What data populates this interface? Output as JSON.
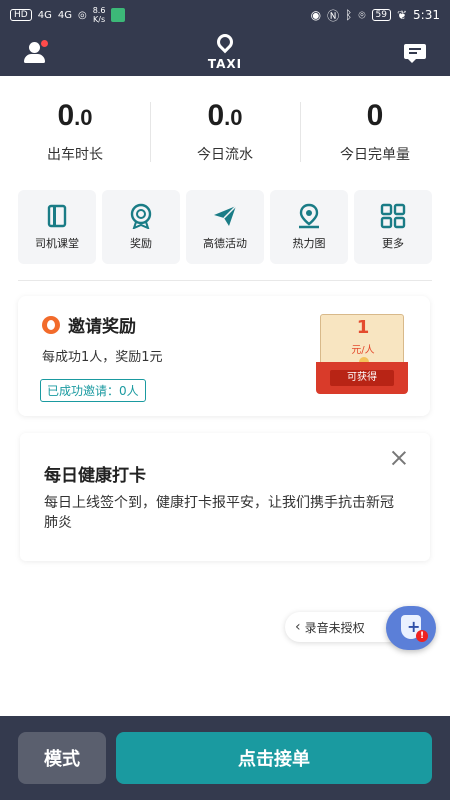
{
  "status_bar": {
    "network_badge": "HD",
    "signal_1": "4G",
    "signal_2": "4G",
    "speed_value": "8.6",
    "speed_unit": "K/s",
    "battery": "59",
    "time": "5:31"
  },
  "header": {
    "logo_text": "TAXI"
  },
  "stats": [
    {
      "value_main": "0",
      "value_decimal": ".0",
      "label": "出车时长"
    },
    {
      "value_main": "0",
      "value_decimal": ".0",
      "label": "今日流水"
    },
    {
      "value_main": "0",
      "value_decimal": "",
      "label": "今日完单量"
    }
  ],
  "tools": [
    {
      "icon": "book-icon",
      "label": "司机课堂"
    },
    {
      "icon": "medal-icon",
      "label": "奖励"
    },
    {
      "icon": "paper-plane-icon",
      "label": "高德活动"
    },
    {
      "icon": "map-pin-icon",
      "label": "热力图"
    },
    {
      "icon": "grid-icon",
      "label": "更多"
    }
  ],
  "invite": {
    "title": "邀请奖励",
    "desc": "每成功1人，奖励1元",
    "badge": "已成功邀请：0人",
    "envelope_value": "1",
    "envelope_unit": "元/人",
    "envelope_button": "可获得"
  },
  "health": {
    "title": "每日健康打卡",
    "text": "每日上线签个到，健康打卡报平安，让我们携手抗击新冠肺炎"
  },
  "recording": {
    "label": "录音未授权",
    "alert": "!"
  },
  "bottom": {
    "mode_label": "模式",
    "accept_label": "点击接单"
  },
  "colors": {
    "header_bg": "#343a4e",
    "accent": "#1a9aa0",
    "envelope_red": "#d93b2a"
  }
}
